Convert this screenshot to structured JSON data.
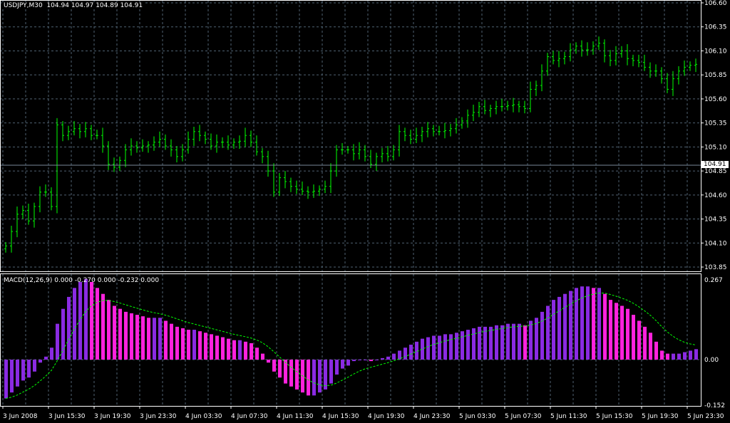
{
  "header": {
    "symbol": "USDJPY,M30",
    "open": "104.94",
    "high": "104.97",
    "low": "104.89",
    "close": "104.91"
  },
  "indicator": {
    "name": "MACD(12,26,9)",
    "values": [
      "0.000",
      "-0.270",
      "0.000",
      "-0.232",
      "0.000"
    ]
  },
  "current_price_label": "104.91",
  "colors": {
    "background": "#000000",
    "bars": "#00ff00",
    "grid": "#4f6272",
    "macd_up": "#8a2be2",
    "macd_down": "#ff22dd",
    "signal": "#00ff00",
    "price_line": "#778899"
  },
  "chart_data": [
    {
      "type": "ohlc",
      "title": "USDJPY,M30",
      "ylim": [
        103.85,
        106.6
      ],
      "y_ticks": [
        "106.60",
        "106.35",
        "106.10",
        "105.85",
        "105.60",
        "105.35",
        "105.10",
        "104.85",
        "104.60",
        "104.35",
        "104.10",
        "103.85"
      ],
      "x_ticks": [
        "3 Jun 2008",
        "3 Jun 15:30",
        "3 Jun 19:30",
        "3 Jun 23:30",
        "4 Jun 03:30",
        "4 Jun 07:30",
        "4 Jun 11:30",
        "4 Jun 15:30",
        "4 Jun 19:30",
        "4 Jun 23:30",
        "5 Jun 03:30",
        "5 Jun 07:30",
        "5 Jun 11:30",
        "5 Jun 15:30",
        "5 Jun 19:30",
        "5 Jun 23:30"
      ],
      "grid": true,
      "current_price": 104.91,
      "closes": [
        104.07,
        104.22,
        104.4,
        104.44,
        104.33,
        104.48,
        104.63,
        104.63,
        104.48,
        105.33,
        105.22,
        105.26,
        105.29,
        105.26,
        105.29,
        105.22,
        105.22,
        105.11,
        104.92,
        104.89,
        104.96,
        105.07,
        105.11,
        105.09,
        105.11,
        105.12,
        105.15,
        105.18,
        105.11,
        105.07,
        105.0,
        105.07,
        105.18,
        105.26,
        105.22,
        105.18,
        105.11,
        105.15,
        105.15,
        105.12,
        105.15,
        105.16,
        105.22,
        105.15,
        105.05,
        105.0,
        104.85,
        104.63,
        104.78,
        104.74,
        104.69,
        104.66,
        104.64,
        104.63,
        104.64,
        104.66,
        104.69,
        104.85,
        105.07,
        105.07,
        105.07,
        105.03,
        105.07,
        105.0,
        104.92,
        105.0,
        105.03,
        105.0,
        105.07,
        105.26,
        105.22,
        105.18,
        105.22,
        105.26,
        105.29,
        105.26,
        105.26,
        105.27,
        105.29,
        105.33,
        105.37,
        105.43,
        105.46,
        105.52,
        105.48,
        105.5,
        105.52,
        105.52,
        105.53,
        105.54,
        105.52,
        105.5,
        105.7,
        105.74,
        105.89,
        106.04,
        106.0,
        106.02,
        106.04,
        106.11,
        106.15,
        106.11,
        106.11,
        106.15,
        106.18,
        106.05,
        106.0,
        106.07,
        106.1,
        106.02,
        106.0,
        105.98,
        105.93,
        105.89,
        105.89,
        105.81,
        105.7,
        105.81,
        105.89,
        105.93,
        105.95,
        105.96
      ]
    },
    {
      "type": "bar",
      "title": "MACD(12,26,9)",
      "ylim": [
        -0.152,
        0.267
      ],
      "y_ticks": [
        "0.267",
        "0.00",
        "-0.152"
      ],
      "values": [
        -0.13,
        -0.11,
        -0.09,
        -0.07,
        -0.06,
        -0.04,
        -0.01,
        0.01,
        0.04,
        0.12,
        0.17,
        0.21,
        0.24,
        0.26,
        0.27,
        0.26,
        0.24,
        0.22,
        0.2,
        0.18,
        0.17,
        0.16,
        0.155,
        0.15,
        0.145,
        0.14,
        0.14,
        0.14,
        0.13,
        0.12,
        0.11,
        0.105,
        0.1,
        0.1,
        0.095,
        0.09,
        0.085,
        0.08,
        0.075,
        0.07,
        0.065,
        0.065,
        0.06,
        0.055,
        0.04,
        0.02,
        -0.01,
        -0.04,
        -0.06,
        -0.08,
        -0.09,
        -0.1,
        -0.11,
        -0.12,
        -0.12,
        -0.11,
        -0.1,
        -0.08,
        -0.05,
        -0.03,
        -0.02,
        -0.005,
        0.0,
        0.0,
        -0.005,
        0.0,
        0.005,
        0.01,
        0.02,
        0.03,
        0.04,
        0.05,
        0.06,
        0.07,
        0.075,
        0.08,
        0.08,
        0.085,
        0.085,
        0.09,
        0.095,
        0.1,
        0.105,
        0.11,
        0.11,
        0.11,
        0.115,
        0.115,
        0.12,
        0.12,
        0.12,
        0.115,
        0.13,
        0.14,
        0.16,
        0.18,
        0.2,
        0.21,
        0.22,
        0.23,
        0.24,
        0.245,
        0.245,
        0.24,
        0.24,
        0.22,
        0.2,
        0.19,
        0.18,
        0.17,
        0.15,
        0.13,
        0.11,
        0.09,
        0.06,
        0.03,
        0.02,
        0.02,
        0.02,
        0.025,
        0.03,
        0.035
      ]
    }
  ]
}
